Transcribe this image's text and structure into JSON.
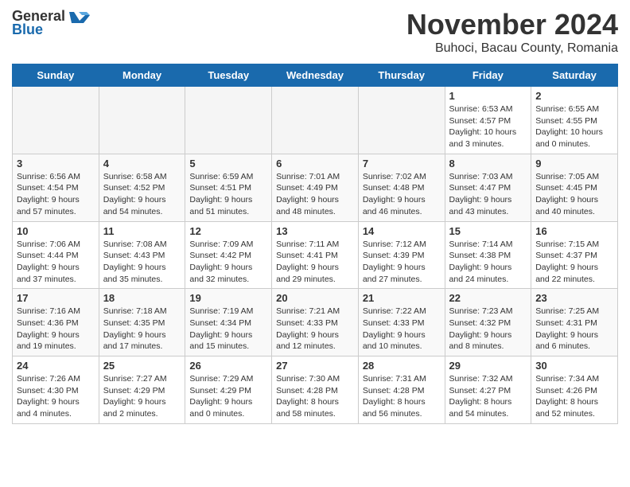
{
  "logo": {
    "general": "General",
    "blue": "Blue"
  },
  "title": "November 2024",
  "location": "Buhoci, Bacau County, Romania",
  "days_header": [
    "Sunday",
    "Monday",
    "Tuesday",
    "Wednesday",
    "Thursday",
    "Friday",
    "Saturday"
  ],
  "weeks": [
    [
      {
        "day": "",
        "info": "",
        "empty": true
      },
      {
        "day": "",
        "info": "",
        "empty": true
      },
      {
        "day": "",
        "info": "",
        "empty": true
      },
      {
        "day": "",
        "info": "",
        "empty": true
      },
      {
        "day": "",
        "info": "",
        "empty": true
      },
      {
        "day": "1",
        "info": "Sunrise: 6:53 AM\nSunset: 4:57 PM\nDaylight: 10 hours\nand 3 minutes."
      },
      {
        "day": "2",
        "info": "Sunrise: 6:55 AM\nSunset: 4:55 PM\nDaylight: 10 hours\nand 0 minutes."
      }
    ],
    [
      {
        "day": "3",
        "info": "Sunrise: 6:56 AM\nSunset: 4:54 PM\nDaylight: 9 hours\nand 57 minutes."
      },
      {
        "day": "4",
        "info": "Sunrise: 6:58 AM\nSunset: 4:52 PM\nDaylight: 9 hours\nand 54 minutes."
      },
      {
        "day": "5",
        "info": "Sunrise: 6:59 AM\nSunset: 4:51 PM\nDaylight: 9 hours\nand 51 minutes."
      },
      {
        "day": "6",
        "info": "Sunrise: 7:01 AM\nSunset: 4:49 PM\nDaylight: 9 hours\nand 48 minutes."
      },
      {
        "day": "7",
        "info": "Sunrise: 7:02 AM\nSunset: 4:48 PM\nDaylight: 9 hours\nand 46 minutes."
      },
      {
        "day": "8",
        "info": "Sunrise: 7:03 AM\nSunset: 4:47 PM\nDaylight: 9 hours\nand 43 minutes."
      },
      {
        "day": "9",
        "info": "Sunrise: 7:05 AM\nSunset: 4:45 PM\nDaylight: 9 hours\nand 40 minutes."
      }
    ],
    [
      {
        "day": "10",
        "info": "Sunrise: 7:06 AM\nSunset: 4:44 PM\nDaylight: 9 hours\nand 37 minutes."
      },
      {
        "day": "11",
        "info": "Sunrise: 7:08 AM\nSunset: 4:43 PM\nDaylight: 9 hours\nand 35 minutes."
      },
      {
        "day": "12",
        "info": "Sunrise: 7:09 AM\nSunset: 4:42 PM\nDaylight: 9 hours\nand 32 minutes."
      },
      {
        "day": "13",
        "info": "Sunrise: 7:11 AM\nSunset: 4:41 PM\nDaylight: 9 hours\nand 29 minutes."
      },
      {
        "day": "14",
        "info": "Sunrise: 7:12 AM\nSunset: 4:39 PM\nDaylight: 9 hours\nand 27 minutes."
      },
      {
        "day": "15",
        "info": "Sunrise: 7:14 AM\nSunset: 4:38 PM\nDaylight: 9 hours\nand 24 minutes."
      },
      {
        "day": "16",
        "info": "Sunrise: 7:15 AM\nSunset: 4:37 PM\nDaylight: 9 hours\nand 22 minutes."
      }
    ],
    [
      {
        "day": "17",
        "info": "Sunrise: 7:16 AM\nSunset: 4:36 PM\nDaylight: 9 hours\nand 19 minutes."
      },
      {
        "day": "18",
        "info": "Sunrise: 7:18 AM\nSunset: 4:35 PM\nDaylight: 9 hours\nand 17 minutes."
      },
      {
        "day": "19",
        "info": "Sunrise: 7:19 AM\nSunset: 4:34 PM\nDaylight: 9 hours\nand 15 minutes."
      },
      {
        "day": "20",
        "info": "Sunrise: 7:21 AM\nSunset: 4:33 PM\nDaylight: 9 hours\nand 12 minutes."
      },
      {
        "day": "21",
        "info": "Sunrise: 7:22 AM\nSunset: 4:33 PM\nDaylight: 9 hours\nand 10 minutes."
      },
      {
        "day": "22",
        "info": "Sunrise: 7:23 AM\nSunset: 4:32 PM\nDaylight: 9 hours\nand 8 minutes."
      },
      {
        "day": "23",
        "info": "Sunrise: 7:25 AM\nSunset: 4:31 PM\nDaylight: 9 hours\nand 6 minutes."
      }
    ],
    [
      {
        "day": "24",
        "info": "Sunrise: 7:26 AM\nSunset: 4:30 PM\nDaylight: 9 hours\nand 4 minutes."
      },
      {
        "day": "25",
        "info": "Sunrise: 7:27 AM\nSunset: 4:29 PM\nDaylight: 9 hours\nand 2 minutes."
      },
      {
        "day": "26",
        "info": "Sunrise: 7:29 AM\nSunset: 4:29 PM\nDaylight: 9 hours\nand 0 minutes."
      },
      {
        "day": "27",
        "info": "Sunrise: 7:30 AM\nSunset: 4:28 PM\nDaylight: 8 hours\nand 58 minutes."
      },
      {
        "day": "28",
        "info": "Sunrise: 7:31 AM\nSunset: 4:28 PM\nDaylight: 8 hours\nand 56 minutes."
      },
      {
        "day": "29",
        "info": "Sunrise: 7:32 AM\nSunset: 4:27 PM\nDaylight: 8 hours\nand 54 minutes."
      },
      {
        "day": "30",
        "info": "Sunrise: 7:34 AM\nSunset: 4:26 PM\nDaylight: 8 hours\nand 52 minutes."
      }
    ]
  ]
}
